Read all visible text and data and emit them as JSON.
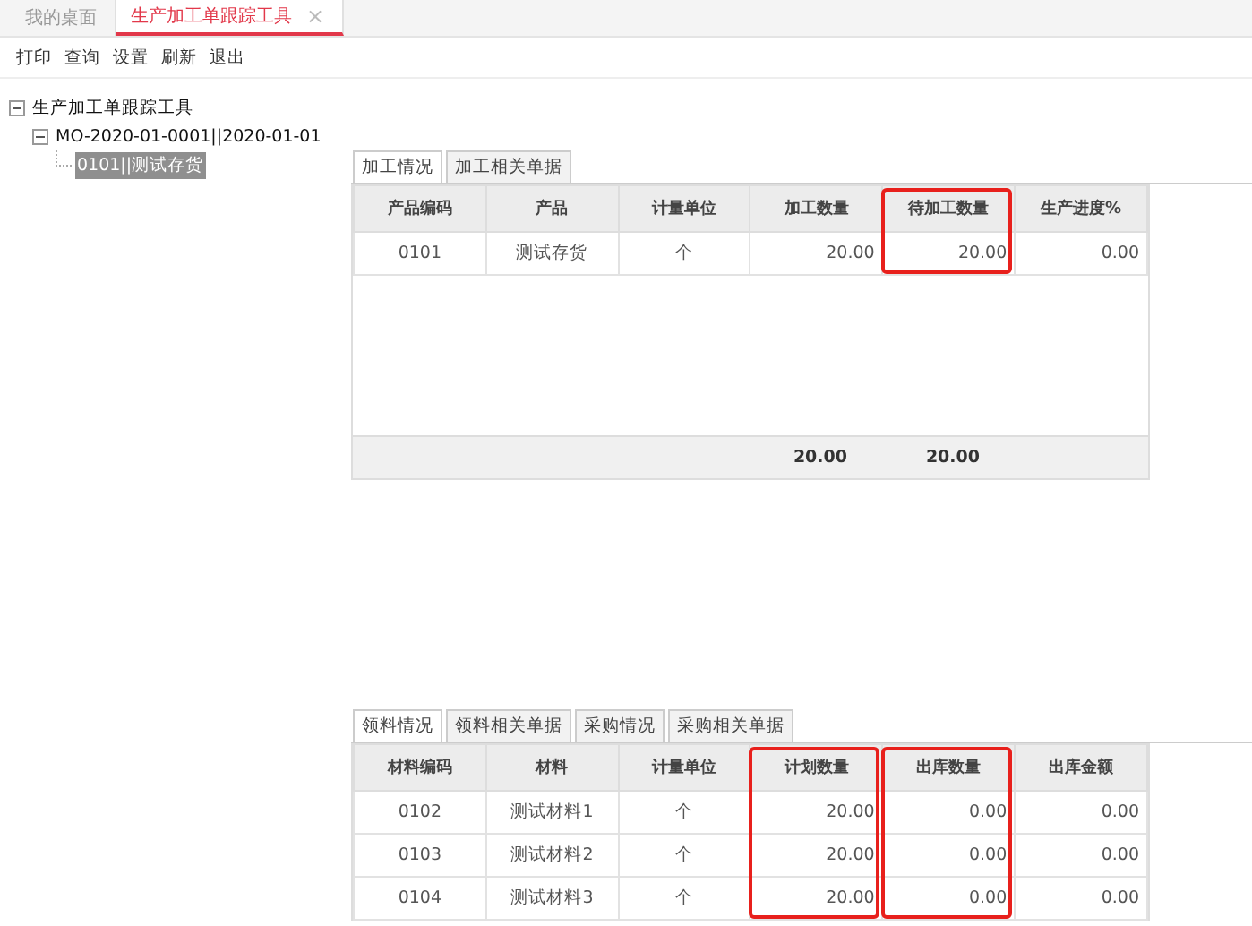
{
  "doc_tabs": [
    {
      "label": "我的桌面",
      "selected": false
    },
    {
      "label": "生产加工单跟踪工具",
      "selected": true,
      "close": "×"
    }
  ],
  "toolbar": [
    "打印",
    "查询",
    "设置",
    "刷新",
    "退出"
  ],
  "tree": [
    {
      "label": "生产加工单跟踪工具",
      "expanded": true,
      "selected": false,
      "children": [
        {
          "label": "MO-2020-01-0001||2020-01-01",
          "expanded": true,
          "selected": false,
          "children": [
            {
              "label": "0101||测试存货",
              "selected": true
            }
          ]
        }
      ]
    }
  ],
  "panels": [
    {
      "tabs": [
        {
          "label": "加工情况",
          "selected": true
        },
        {
          "label": "加工相关单据",
          "selected": false
        }
      ],
      "columns": [
        {
          "label": "产品编码",
          "kind": "text",
          "highlighted": false
        },
        {
          "label": "产品",
          "kind": "text",
          "highlighted": false
        },
        {
          "label": "计量单位",
          "kind": "text",
          "highlighted": false
        },
        {
          "label": "加工数量",
          "kind": "number",
          "highlighted": false,
          "total": "20.00"
        },
        {
          "label": "待加工数量",
          "kind": "number",
          "highlighted": true,
          "total": "20.00"
        },
        {
          "label": "生产进度%",
          "kind": "number",
          "highlighted": false
        }
      ],
      "rows": [
        [
          "0101",
          "测试存货",
          "个",
          "20.00",
          "20.00",
          "0.00"
        ]
      ]
    },
    {
      "tabs": [
        {
          "label": "领料情况",
          "selected": true
        },
        {
          "label": "领料相关单据",
          "selected": false
        },
        {
          "label": "采购情况",
          "selected": false
        },
        {
          "label": "采购相关单据",
          "selected": false
        }
      ],
      "columns": [
        {
          "label": "材料编码",
          "kind": "text",
          "highlighted": false
        },
        {
          "label": "材料",
          "kind": "text",
          "highlighted": false
        },
        {
          "label": "计量单位",
          "kind": "text",
          "highlighted": false
        },
        {
          "label": "计划数量",
          "kind": "number",
          "highlighted": true
        },
        {
          "label": "出库数量",
          "kind": "number",
          "highlighted": true
        },
        {
          "label": "出库金额",
          "kind": "number",
          "highlighted": false
        }
      ],
      "rows": [
        [
          "0102",
          "测试材料1",
          "个",
          "20.00",
          "0.00",
          "0.00"
        ],
        [
          "0103",
          "测试材料2",
          "个",
          "20.00",
          "0.00",
          "0.00"
        ],
        [
          "0104",
          "测试材料3",
          "个",
          "20.00",
          "0.00",
          "0.00"
        ]
      ]
    }
  ]
}
